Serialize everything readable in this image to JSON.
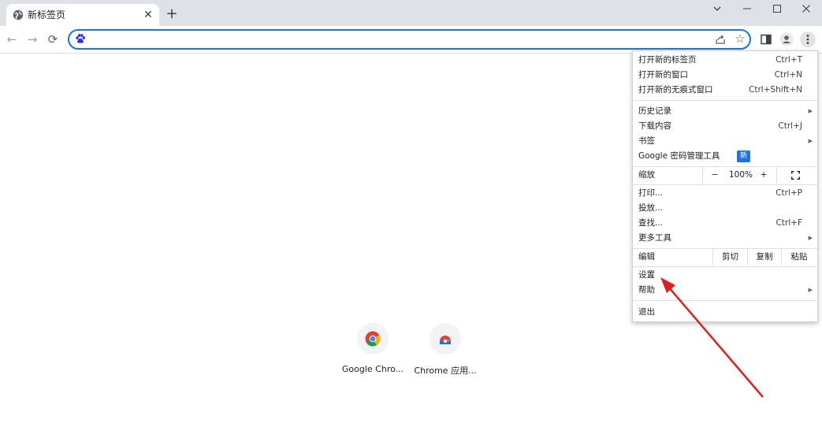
{
  "tab": {
    "title": "新标签页",
    "close": "✕"
  },
  "tabstrip": {
    "new_tab": "+"
  },
  "window": {
    "dropdown": "⌄",
    "minimize": "—",
    "maximize": "☐",
    "close": "✕"
  },
  "nav": {
    "back": "←",
    "forward": "→",
    "reload": "⟳"
  },
  "omnibox": {
    "value": "",
    "placeholder": ""
  },
  "shortcuts": [
    {
      "label": "Google Chro..."
    },
    {
      "label": "Chrome 应用..."
    }
  ],
  "menu": {
    "new_tab": {
      "label": "打开新的标签页",
      "shortcut": "Ctrl+T"
    },
    "new_window": {
      "label": "打开新的窗口",
      "shortcut": "Ctrl+N"
    },
    "incognito": {
      "label": "打开新的无痕式窗口",
      "shortcut": "Ctrl+Shift+N"
    },
    "history": {
      "label": "历史记录"
    },
    "downloads": {
      "label": "下载内容",
      "shortcut": "Ctrl+J"
    },
    "bookmarks": {
      "label": "书签"
    },
    "password_manager": {
      "label": "Google 密码管理工具",
      "badge": "新"
    },
    "zoom": {
      "label": "缩放",
      "minus": "−",
      "value": "100%",
      "plus": "+"
    },
    "print": {
      "label": "打印...",
      "shortcut": "Ctrl+P"
    },
    "cast": {
      "label": "投放..."
    },
    "find": {
      "label": "查找...",
      "shortcut": "Ctrl+F"
    },
    "more_tools": {
      "label": "更多工具"
    },
    "edit": {
      "label": "编辑",
      "cut": "剪切",
      "copy": "复制",
      "paste": "粘贴"
    },
    "settings": {
      "label": "设置"
    },
    "help": {
      "label": "帮助"
    },
    "exit": {
      "label": "退出"
    },
    "submenu_arrow": "▶"
  },
  "colors": {
    "accent": "#1a73e8",
    "annotation_arrow": "#e02020",
    "tabstrip_bg": "#dee1e6"
  }
}
